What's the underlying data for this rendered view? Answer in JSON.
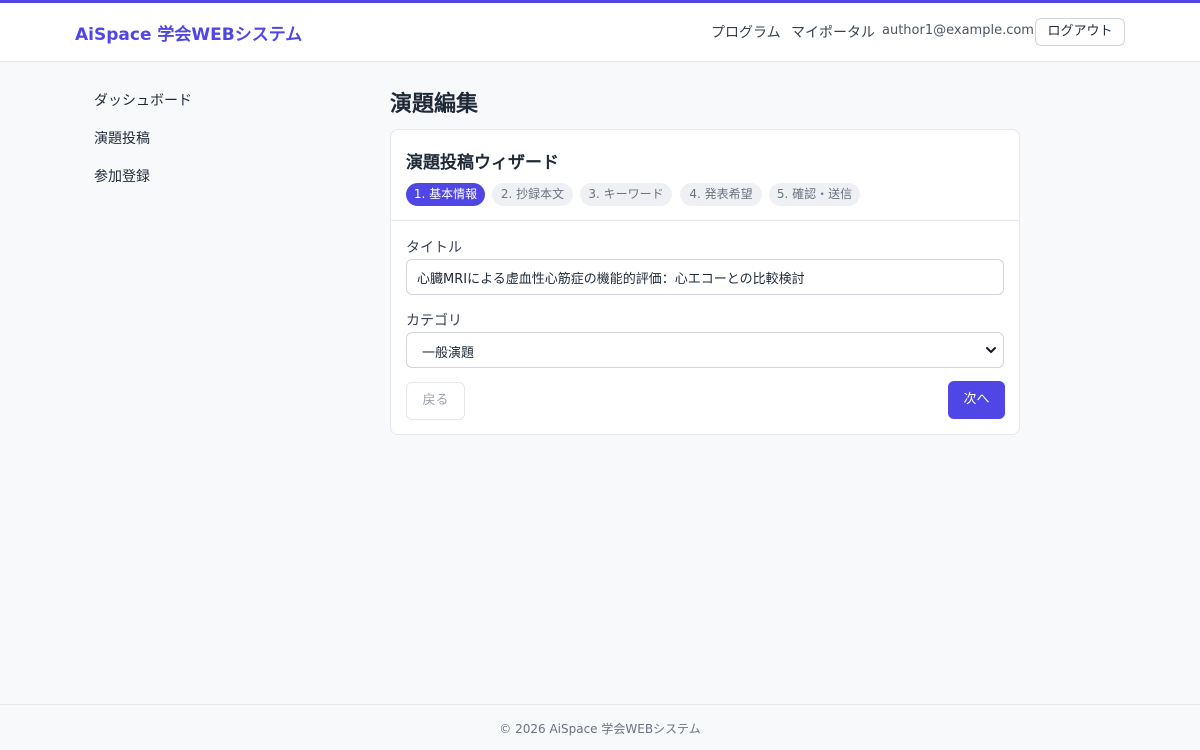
{
  "header": {
    "brand": "AiSpace 学会WEBシステム",
    "nav": {
      "program": "プログラム",
      "portal": "マイポータル"
    },
    "user_email": "author1@example.com",
    "logout_label": "ログアウト"
  },
  "sidebar": {
    "items": [
      {
        "label": "ダッシュボード"
      },
      {
        "label": "演題投稿"
      },
      {
        "label": "参加登録"
      }
    ]
  },
  "main": {
    "page_title": "演題編集",
    "wizard": {
      "title": "演題投稿ウィザード",
      "steps": [
        {
          "label": "1. 基本情報",
          "active": true
        },
        {
          "label": "2. 抄録本文",
          "active": false
        },
        {
          "label": "3. キーワード",
          "active": false
        },
        {
          "label": "4. 発表希望",
          "active": false
        },
        {
          "label": "5. 確認・送信",
          "active": false
        }
      ],
      "fields": {
        "title": {
          "label": "タイトル",
          "value": "心臓MRIによる虚血性心筋症の機能的評価：心エコーとの比較検討"
        },
        "category": {
          "label": "カテゴリ",
          "selected": "一般演題"
        }
      },
      "back_label": "戻る",
      "next_label": "次へ"
    }
  },
  "footer": {
    "text": "© 2026 AiSpace 学会WEBシステム"
  },
  "colors": {
    "accent": "#4f46e5",
    "background": "#f8f9fb",
    "border": "#e5e7eb"
  }
}
